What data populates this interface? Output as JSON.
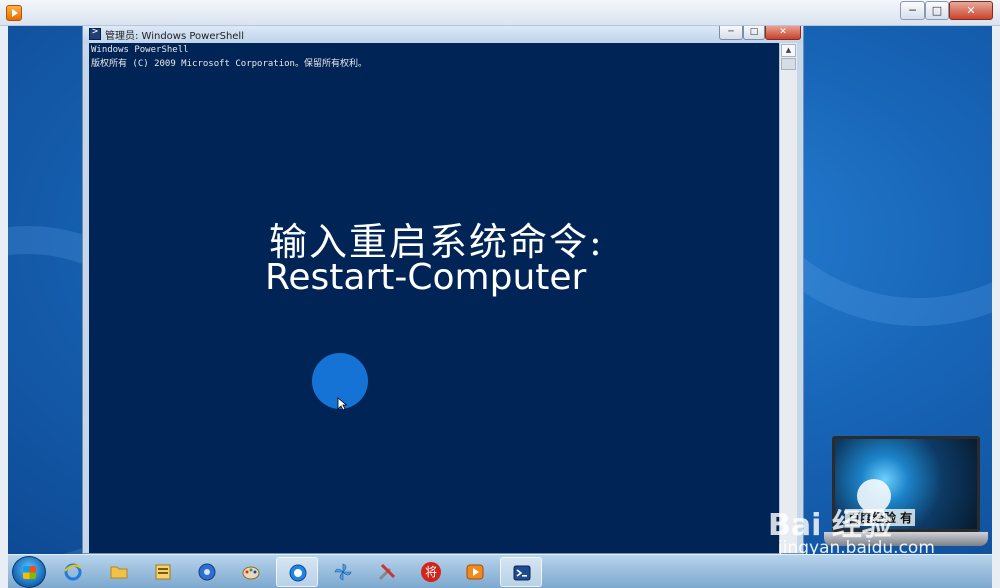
{
  "player": {
    "title_icon": "video-player-icon",
    "controls": {
      "minimize": "─",
      "maximize": "□",
      "close": "✕"
    }
  },
  "powershell": {
    "title": "管理员: Windows PowerShell",
    "controls": {
      "minimize": "─",
      "maximize": "□",
      "close": "✕"
    },
    "console_lines": [
      "Windows PowerShell",
      "版权所有 (C) 2009 Microsoft Corporation。保留所有权利。"
    ],
    "background_color": "#012456"
  },
  "overlay": {
    "line1": "输入重启系统命令:",
    "line2": "Restart-Computer"
  },
  "watermark": {
    "laptop_text": "百度经验 有",
    "logo": "Bai 经验",
    "url": "jingyan.baidu.com"
  },
  "taskbar": {
    "items": [
      {
        "name": "start-button",
        "icon": "windows-logo-icon"
      },
      {
        "name": "ie",
        "icon": "internet-explorer-icon"
      },
      {
        "name": "folder",
        "icon": "folder-icon"
      },
      {
        "name": "explorer",
        "icon": "file-manager-icon"
      },
      {
        "name": "media",
        "icon": "media-center-icon"
      },
      {
        "name": "paint",
        "icon": "paint-icon"
      },
      {
        "name": "browser",
        "icon": "browser-icon",
        "active": true
      },
      {
        "name": "pinwheel",
        "icon": "pinwheel-icon"
      },
      {
        "name": "tools",
        "icon": "tools-icon"
      },
      {
        "name": "chess",
        "icon": "chinese-chess-icon",
        "label": "将"
      },
      {
        "name": "video",
        "icon": "video-player-icon"
      },
      {
        "name": "powershell",
        "icon": "powershell-icon",
        "active": true
      }
    ]
  }
}
